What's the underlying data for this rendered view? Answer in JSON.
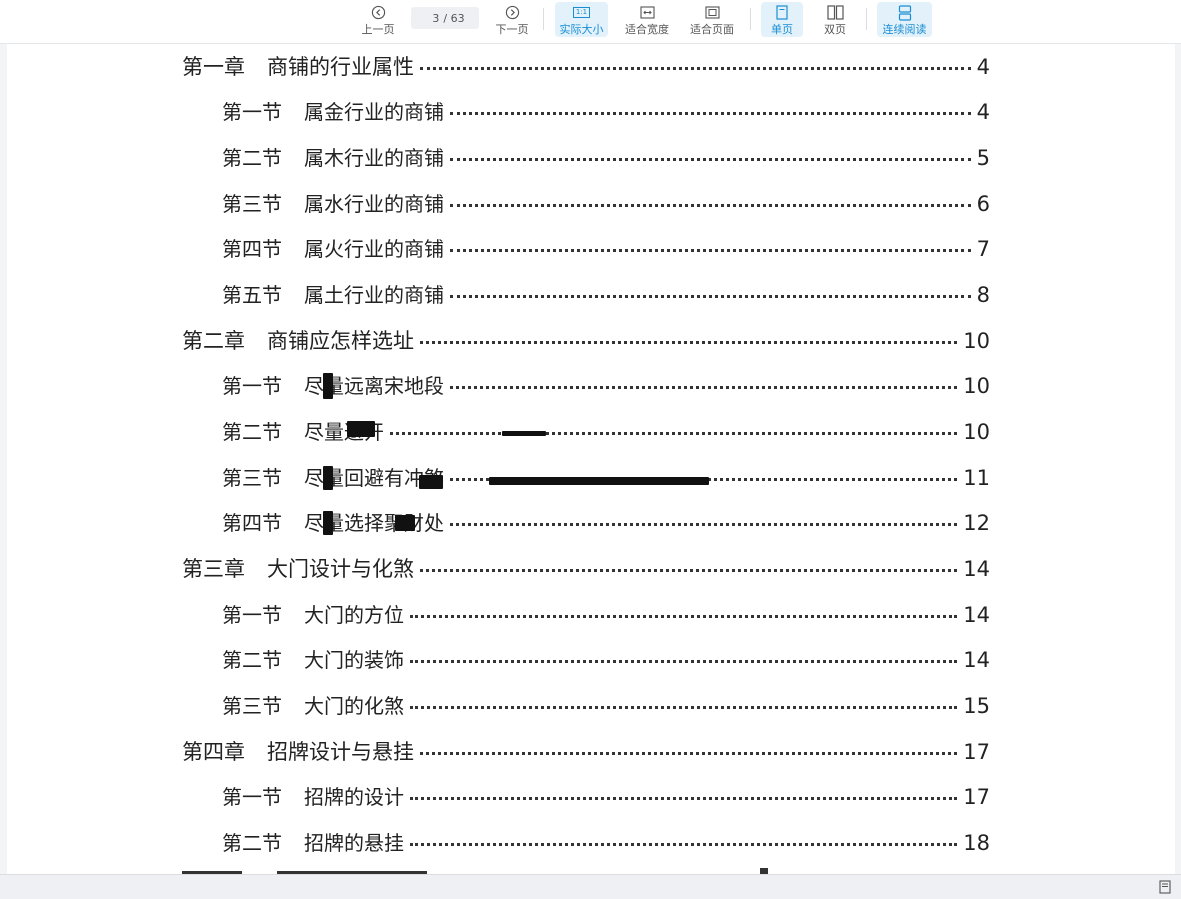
{
  "toolbar": {
    "prev_label": "上一页",
    "current_page": "3",
    "total_pages": "/ 63",
    "next_label": "下一页",
    "actual_size_label": "实际大小",
    "actual_size_icon_text": "1:1",
    "fit_width_label": "适合宽度",
    "fit_page_label": "适合页面",
    "single_page_label": "单页",
    "double_page_label": "双页",
    "continuous_label": "连续阅读",
    "accent_color": "#1a8ed4"
  },
  "toc": [
    {
      "level": "chapter",
      "num": "第一章",
      "title": "商铺的行业属性",
      "page": "4"
    },
    {
      "level": "section",
      "num": "第一节",
      "title": "属金行业的商铺",
      "page": "4"
    },
    {
      "level": "section",
      "num": "第二节",
      "title": "属木行业的商铺",
      "page": "5"
    },
    {
      "level": "section",
      "num": "第三节",
      "title": "属水行业的商铺",
      "page": "6"
    },
    {
      "level": "section",
      "num": "第四节",
      "title": "属火行业的商铺",
      "page": "7"
    },
    {
      "level": "section",
      "num": "第五节",
      "title": "属土行业的商铺",
      "page": "8"
    },
    {
      "level": "chapter",
      "num": "第二章",
      "title": "商铺应怎样选址",
      "page": "10"
    },
    {
      "level": "section",
      "num": "第一节",
      "title": "尽量远离宋地段",
      "page": "10"
    },
    {
      "level": "section",
      "num": "第二节",
      "title": "尽量避开",
      "page": "10"
    },
    {
      "level": "section",
      "num": "第三节",
      "title": "尽量回避有冲煞",
      "page": "11"
    },
    {
      "level": "section",
      "num": "第四节",
      "title": "尽量选择聚财处",
      "page": "12"
    },
    {
      "level": "chapter",
      "num": "第三章",
      "title": "大门设计与化煞",
      "page": "14"
    },
    {
      "level": "section",
      "num": "第一节",
      "title": "大门的方位",
      "page": "14"
    },
    {
      "level": "section",
      "num": "第二节",
      "title": "大门的装饰",
      "page": "14"
    },
    {
      "level": "section",
      "num": "第三节",
      "title": "大门的化煞",
      "page": "15"
    },
    {
      "level": "chapter",
      "num": "第四章",
      "title": "招牌设计与悬挂",
      "page": "17"
    },
    {
      "level": "section",
      "num": "第一节",
      "title": "招牌的设计",
      "page": "17"
    },
    {
      "level": "section",
      "num": "第二节",
      "title": "招牌的悬挂",
      "page": "18"
    }
  ]
}
